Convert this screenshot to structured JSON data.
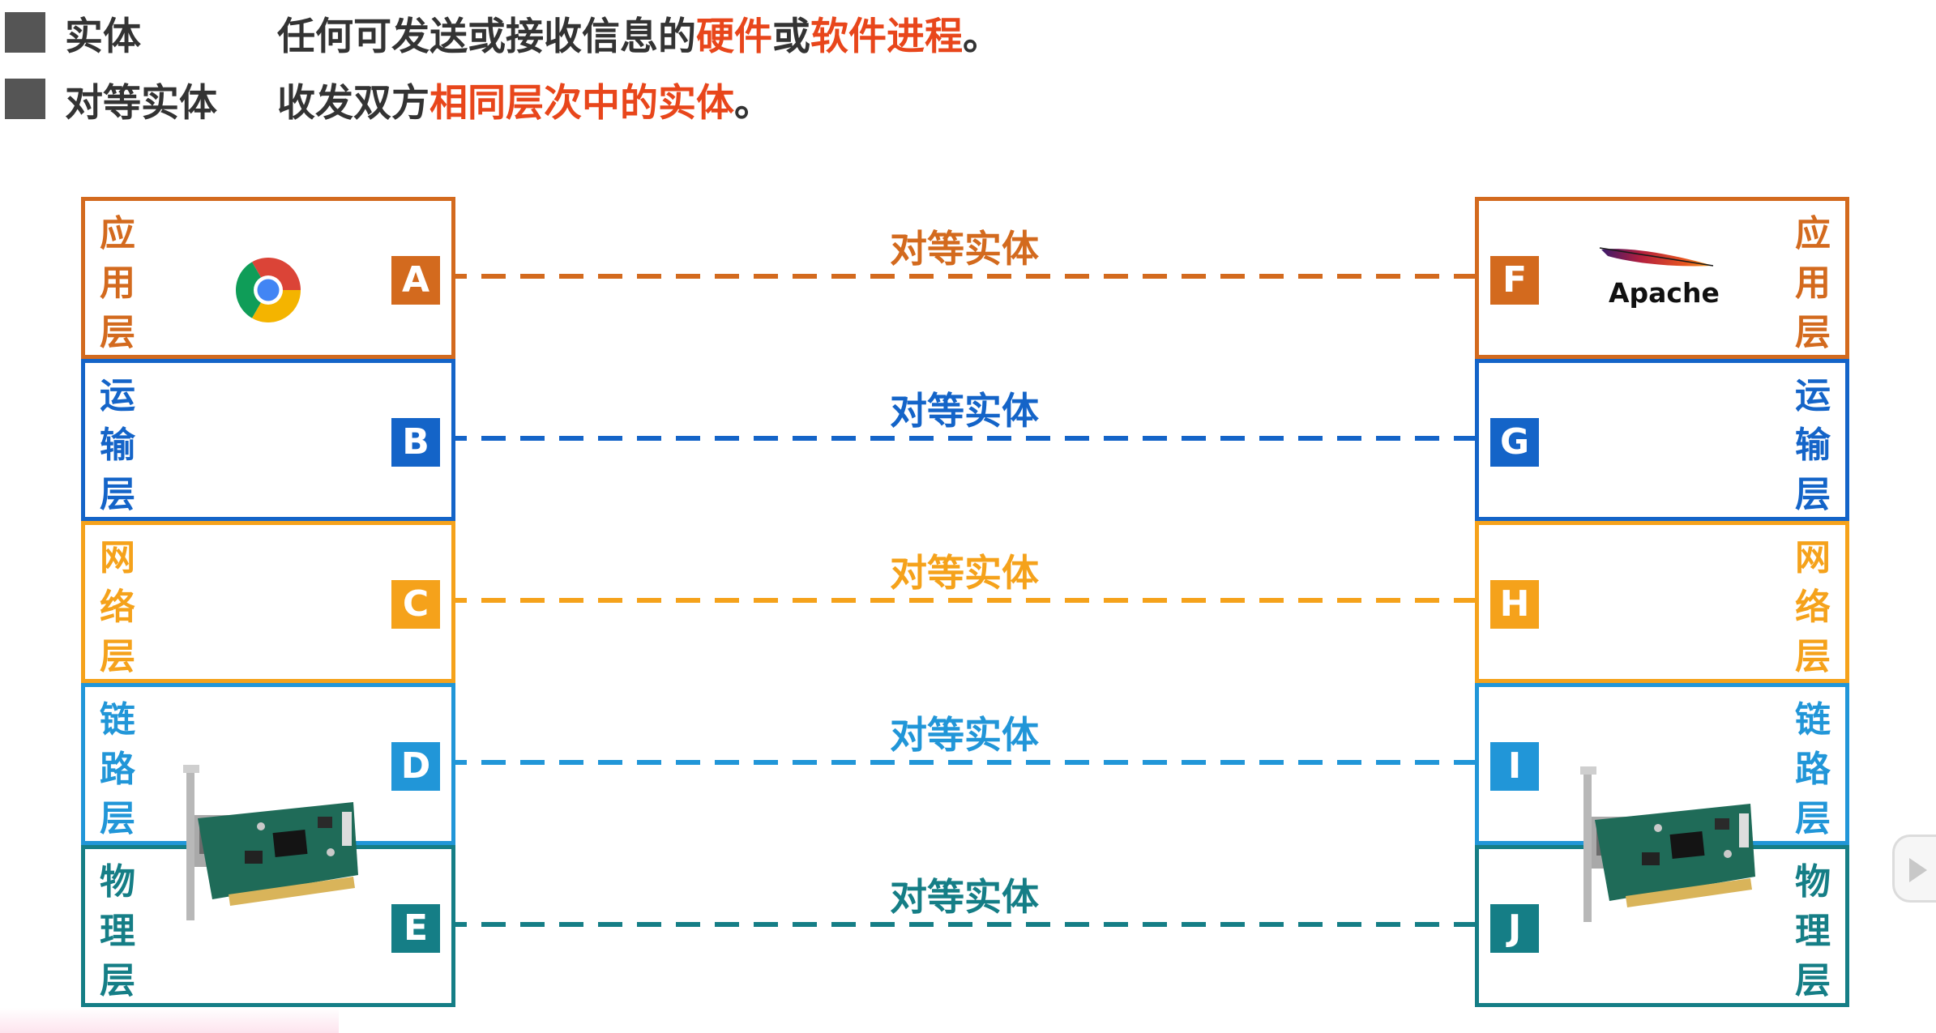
{
  "definitions": [
    {
      "term": "实体",
      "parts": [
        {
          "text": "任何可发送或接收信息的",
          "highlight": false
        },
        {
          "text": "硬件",
          "highlight": true
        },
        {
          "text": "或",
          "highlight": false
        },
        {
          "text": "软件进程",
          "highlight": true
        },
        {
          "text": "。",
          "highlight": false
        }
      ]
    },
    {
      "term": "对等实体",
      "parts": [
        {
          "text": "收发双方",
          "highlight": false
        },
        {
          "text": "相同层次中的实体",
          "highlight": true
        },
        {
          "text": "。",
          "highlight": false
        }
      ]
    }
  ],
  "colors": {
    "highlight": "#e8461b",
    "text": "#333333",
    "bullet": "#555555",
    "application": "#d36a1e",
    "transport": "#1464c8",
    "network": "#f5a21b",
    "datalink": "#2196d8",
    "physical": "#157e86"
  },
  "layers": [
    {
      "name_chars": [
        "应",
        "用",
        "层"
      ],
      "left_badge": "A",
      "right_badge": "F",
      "peer_label": "对等实体",
      "color_key": "application"
    },
    {
      "name_chars": [
        "运",
        "输",
        "层"
      ],
      "left_badge": "B",
      "right_badge": "G",
      "peer_label": "对等实体",
      "color_key": "transport"
    },
    {
      "name_chars": [
        "网",
        "络",
        "层"
      ],
      "left_badge": "C",
      "right_badge": "H",
      "peer_label": "对等实体",
      "color_key": "network"
    },
    {
      "name_chars": [
        "链",
        "路",
        "层"
      ],
      "left_badge": "D",
      "right_badge": "I",
      "peer_label": "对等实体",
      "color_key": "datalink"
    },
    {
      "name_chars": [
        "物",
        "理",
        "层"
      ],
      "left_badge": "E",
      "right_badge": "J",
      "peer_label": "对等实体",
      "color_key": "physical"
    }
  ],
  "logos": {
    "left_app": "chrome-logo",
    "right_app": "apache-logo",
    "right_app_text": "Apache",
    "nic": "network-interface-card"
  }
}
